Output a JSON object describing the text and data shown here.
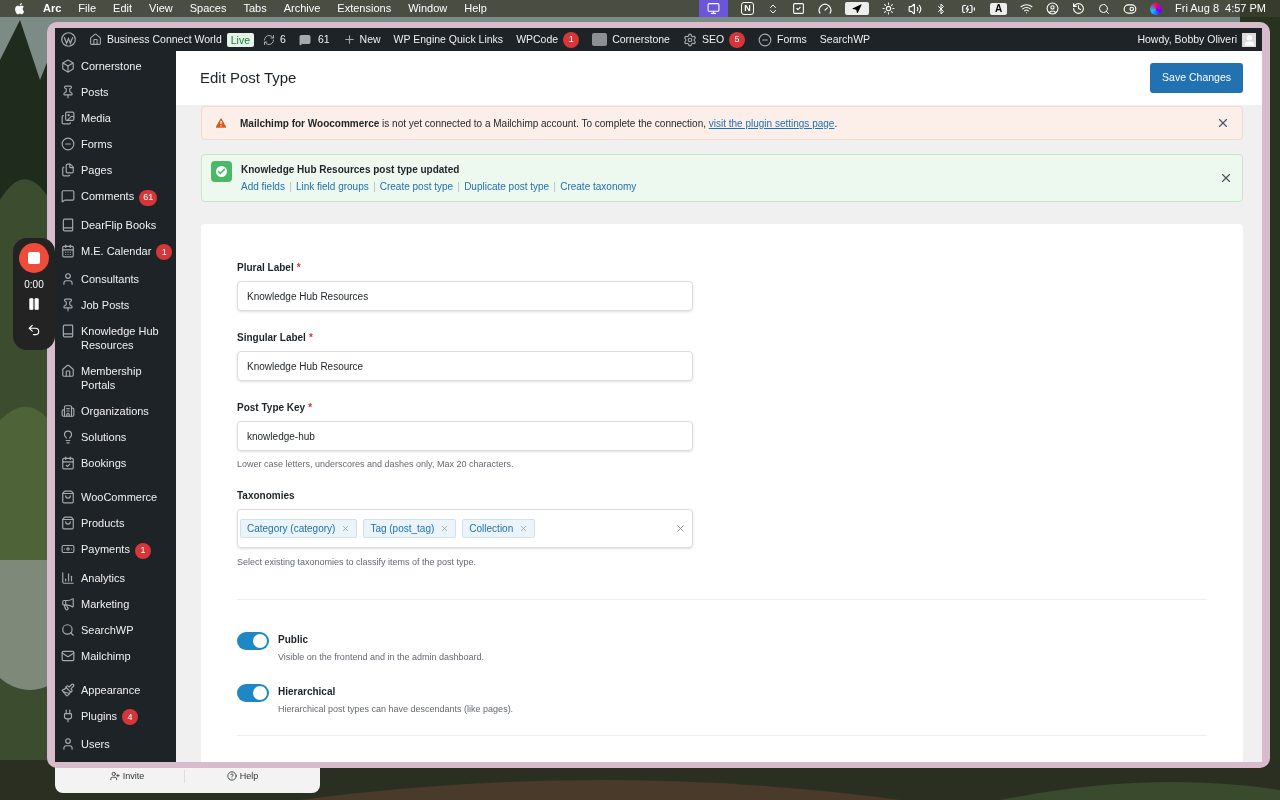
{
  "menubar": {
    "app": "Arc",
    "menus": [
      "File",
      "Edit",
      "View",
      "Spaces",
      "Tabs",
      "Archive",
      "Extensions",
      "Window",
      "Help"
    ],
    "notion_letter": "N",
    "input_source": "A",
    "date": "Fri Aug 8",
    "time": "4:57 PM"
  },
  "recorder": {
    "time": "0:00"
  },
  "admin_bar": {
    "site": "Business Connect World",
    "status": "Live",
    "updates": "6",
    "comments": "61",
    "new": "New",
    "items": [
      {
        "label": "WP Engine Quick Links"
      },
      {
        "label": "WPCode",
        "badge": "1"
      },
      {
        "label": "Cornerstone"
      },
      {
        "label": "SEO",
        "badge": "5"
      },
      {
        "label": "Forms"
      },
      {
        "label": "SearchWP"
      }
    ],
    "greeting": "Howdy, Bobby Oliveri"
  },
  "sidebar": {
    "groups": [
      [
        {
          "label": "Cornerstone"
        },
        {
          "label": "Posts"
        },
        {
          "label": "Media"
        },
        {
          "label": "Forms"
        },
        {
          "label": "Pages"
        },
        {
          "label": "Comments",
          "badge": "61"
        },
        {
          "label": "DearFlip Books"
        },
        {
          "label": "M.E. Calendar",
          "badge": "1"
        },
        {
          "label": "Consultants"
        },
        {
          "label": "Job Posts"
        },
        {
          "label": "Knowledge Hub Resources"
        },
        {
          "label": "Membership Portals"
        },
        {
          "label": "Organizations"
        },
        {
          "label": "Solutions"
        },
        {
          "label": "Bookings"
        }
      ],
      [
        {
          "label": "WooCommerce"
        },
        {
          "label": "Products"
        },
        {
          "label": "Payments",
          "badge": "1"
        },
        {
          "label": "Analytics"
        },
        {
          "label": "Marketing"
        },
        {
          "label": "SearchWP"
        },
        {
          "label": "Mailchimp"
        }
      ],
      [
        {
          "label": "Appearance"
        },
        {
          "label": "Plugins",
          "badge": "4"
        },
        {
          "label": "Users"
        }
      ]
    ]
  },
  "page": {
    "title": "Edit Post Type",
    "save_button": "Save Changes"
  },
  "notices": [
    {
      "kind": "warning",
      "text": "**Mailchimp for Woocommerce** is not yet connected to a Mailchimp account. To complete the connection,",
      "link": "visit the plugin settings page",
      "after": "."
    },
    {
      "kind": "success",
      "title": "Knowledge Hub Resources post type updated",
      "links": [
        "Add fields",
        "Link field groups",
        "Create post type",
        "Duplicate post type",
        "Create taxonomy"
      ]
    }
  ],
  "form": {
    "required_mark": "*",
    "fields": [
      {
        "label": "Plural Label",
        "required": true,
        "value": "Knowledge Hub Resources"
      },
      {
        "label": "Singular Label",
        "required": true,
        "value": "Knowledge Hub Resource"
      },
      {
        "label": "Post Type Key",
        "required": true,
        "value": "knowledge-hub",
        "hint": "Lower case letters, underscores and dashes only, Max 20 characters."
      }
    ],
    "taxonomies": {
      "label": "Taxonomies",
      "tags": [
        "Category (category)",
        "Tag (post_tag)",
        "Collection"
      ],
      "hint": "Select existing taxonomies to classify items of the post type."
    },
    "toggles": [
      {
        "label": "Public",
        "description": "Visible on the frontend and in the admin dashboard.",
        "on": true
      },
      {
        "label": "Hierarchical",
        "description": "Hierarchical post types can have descendants (like pages).",
        "on": true
      }
    ]
  },
  "bottom_bar": {
    "buttons": [
      "Invite",
      "Help"
    ]
  }
}
